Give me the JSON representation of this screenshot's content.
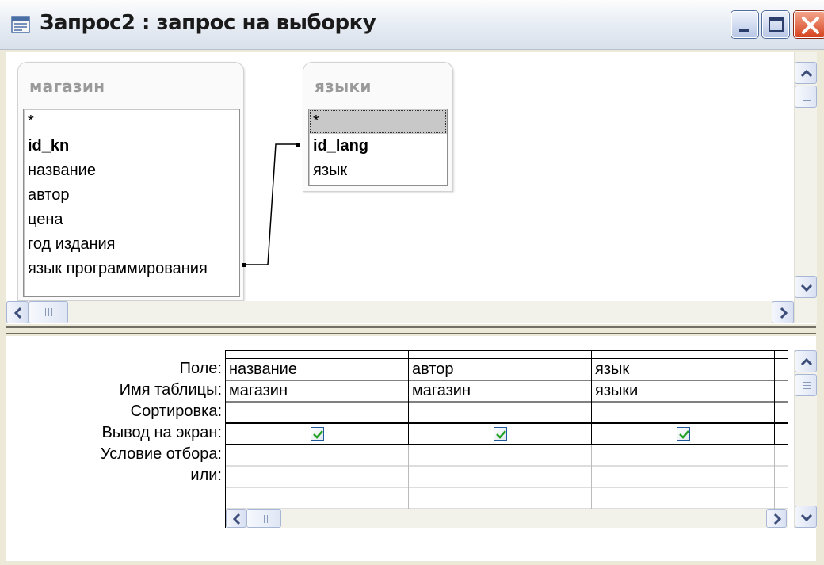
{
  "window": {
    "title": "Запрос2 : запрос на выборку"
  },
  "tables": [
    {
      "name": "магазин",
      "fields": [
        {
          "label": "*",
          "primary": false
        },
        {
          "label": "id_kn",
          "primary": true
        },
        {
          "label": "название",
          "primary": false
        },
        {
          "label": "автор",
          "primary": false
        },
        {
          "label": "цена",
          "primary": false
        },
        {
          "label": "год издания",
          "primary": false
        },
        {
          "label": "язык программирования",
          "primary": false
        }
      ]
    },
    {
      "name": "языки",
      "fields": [
        {
          "label": "*",
          "primary": false,
          "selected": true
        },
        {
          "label": "id_lang",
          "primary": true
        },
        {
          "label": "язык",
          "primary": false
        }
      ]
    }
  ],
  "relationship": {
    "from_table": "магазин",
    "from_field": "язык программирования",
    "to_table": "языки",
    "to_field": "id_lang"
  },
  "grid": {
    "row_labels": [
      "Поле:",
      "Имя таблицы:",
      "Сортировка:",
      "Вывод на экран:",
      "Условие отбора:",
      "или:"
    ],
    "columns": [
      {
        "field": "название",
        "table": "магазин",
        "sort": "",
        "show": true,
        "criteria": "",
        "or": ""
      },
      {
        "field": "автор",
        "table": "магазин",
        "sort": "",
        "show": true,
        "criteria": "",
        "or": ""
      },
      {
        "field": "язык",
        "table": "языки",
        "sort": "",
        "show": true,
        "criteria": "",
        "or": ""
      }
    ]
  },
  "icons": {
    "title": "query-window-icon",
    "minimize": "minimize-icon",
    "maximize": "maximize-icon",
    "close": "close-icon",
    "scroll_up": "chevron-up-icon",
    "scroll_down": "chevron-down-icon",
    "scroll_left": "chevron-left-icon",
    "scroll_right": "chevron-right-icon",
    "checkmark": "checkmark-icon"
  },
  "colors": {
    "close_button": "#d6431f",
    "checkbox_border": "#1e5a9c",
    "checkmark": "#21a121",
    "selection": "#c8c8c8"
  }
}
